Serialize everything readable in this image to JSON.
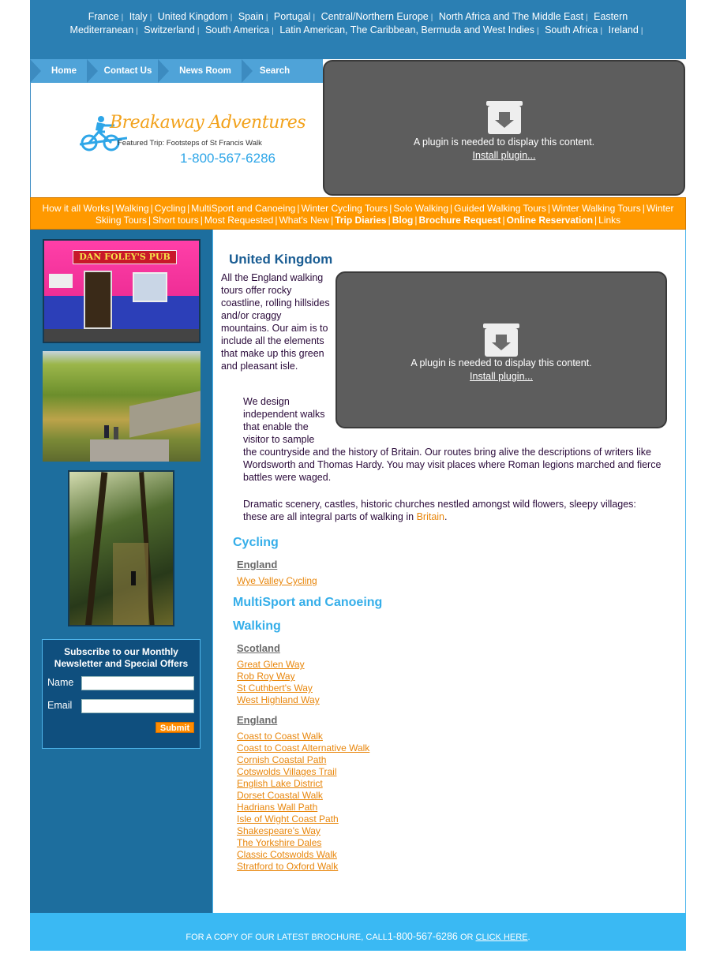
{
  "regions": [
    "France",
    "Italy",
    "United Kingdom",
    "Spain",
    "Portugal",
    "Central/Northern Europe",
    "North Africa and The Middle East",
    "Eastern Mediterranean",
    "Switzerland",
    "South America",
    "Latin American, The Caribbean, Bermuda and West Indies",
    "South Africa",
    "Ireland"
  ],
  "region_separator": "|",
  "nav": {
    "home": "Home",
    "contact": "Contact Us",
    "news": "News Room",
    "search": "Search"
  },
  "logo": {
    "name": "Breakaway Adventures",
    "featured": "Featured Trip: Footsteps of St Francis Walk",
    "phone": "1-800-567-6286"
  },
  "plugin": {
    "message": "A plugin is needed to display this content.",
    "link": "Install plugin..."
  },
  "orange_menu": [
    {
      "label": "How it all Works",
      "bold": false
    },
    {
      "label": "Walking",
      "bold": false
    },
    {
      "label": "Cycling",
      "bold": false
    },
    {
      "label": "MultiSport and Canoeing",
      "bold": false
    },
    {
      "label": "Winter Cycling Tours",
      "bold": false
    },
    {
      "label": "Solo Walking",
      "bold": false
    },
    {
      "label": "Guided Walking Tours",
      "bold": false
    },
    {
      "label": "Winter Walking Tours",
      "bold": false
    },
    {
      "label": "Winter Skiing Tours",
      "bold": false
    },
    {
      "label": "Short tours",
      "bold": false
    },
    {
      "label": "Most Requested",
      "bold": false
    },
    {
      "label": "What's New",
      "bold": false
    },
    {
      "label": "Trip Diaries",
      "bold": true
    },
    {
      "label": "Blog",
      "bold": true
    },
    {
      "label": "Brochure Request",
      "bold": true
    },
    {
      "label": "Online Reservation",
      "bold": true
    },
    {
      "label": "Links",
      "bold": false
    }
  ],
  "sidebar": {
    "photo1_sign": "DAN FOLEY'S PUB",
    "subscribe_title": "Subscribe to our Monthly Newsletter and Special Offers",
    "name_label": "Name",
    "email_label": "Email",
    "submit_label": "Submit"
  },
  "content": {
    "heading": "United Kingdom",
    "intro": "All the England walking tours offer rocky coastline, rolling hillsides and/or craggy mountains. Our aim is to include all the elements that make up this green and pleasant isle.",
    "para2": "We design independent walks that enable the visitor to sample the countryside and the history of Britain. Our routes bring alive the descriptions of writers like Wordsworth and Thomas Hardy. You may visit places where Roman legions marched and fierce battles were waged.",
    "para3_text": "Dramatic scenery, castles, historic churches nestled amongst wild flowers, sleepy villages: these are all integral parts of walking in ",
    "para3_link": "Britain",
    "para3_end": ".",
    "cycling": {
      "title": "Cycling",
      "england_label": "England",
      "england_links": [
        "Wye Valley Cycling"
      ]
    },
    "multisport": {
      "title": "MultiSport and Canoeing"
    },
    "walking": {
      "title": "Walking",
      "scotland_label": "Scotland",
      "scotland_links": [
        "Great Glen Way",
        "Rob Roy Way",
        "St Cuthbert's Way",
        "West Highland Way"
      ],
      "england_label": "England",
      "england_links": [
        "Coast to Coast Walk",
        "Coast to Coast Alternative Walk",
        "Cornish Coastal Path",
        "Cotswolds Villages Trail",
        "English Lake District",
        "Dorset Coastal Walk",
        "Hadrians Wall Path",
        "Isle of Wight Coast Path",
        "Shakespeare's Way",
        "The Yorkshire Dales",
        "Classic Cotswolds Walk",
        "Stratford to Oxford Walk"
      ]
    }
  },
  "footer": {
    "text": "FOR A COPY OF OUR LATEST BROCHURE, CALL",
    "phone": "1-800-567-6286",
    "or": "OR",
    "link": "CLICK HERE",
    "end": "."
  }
}
